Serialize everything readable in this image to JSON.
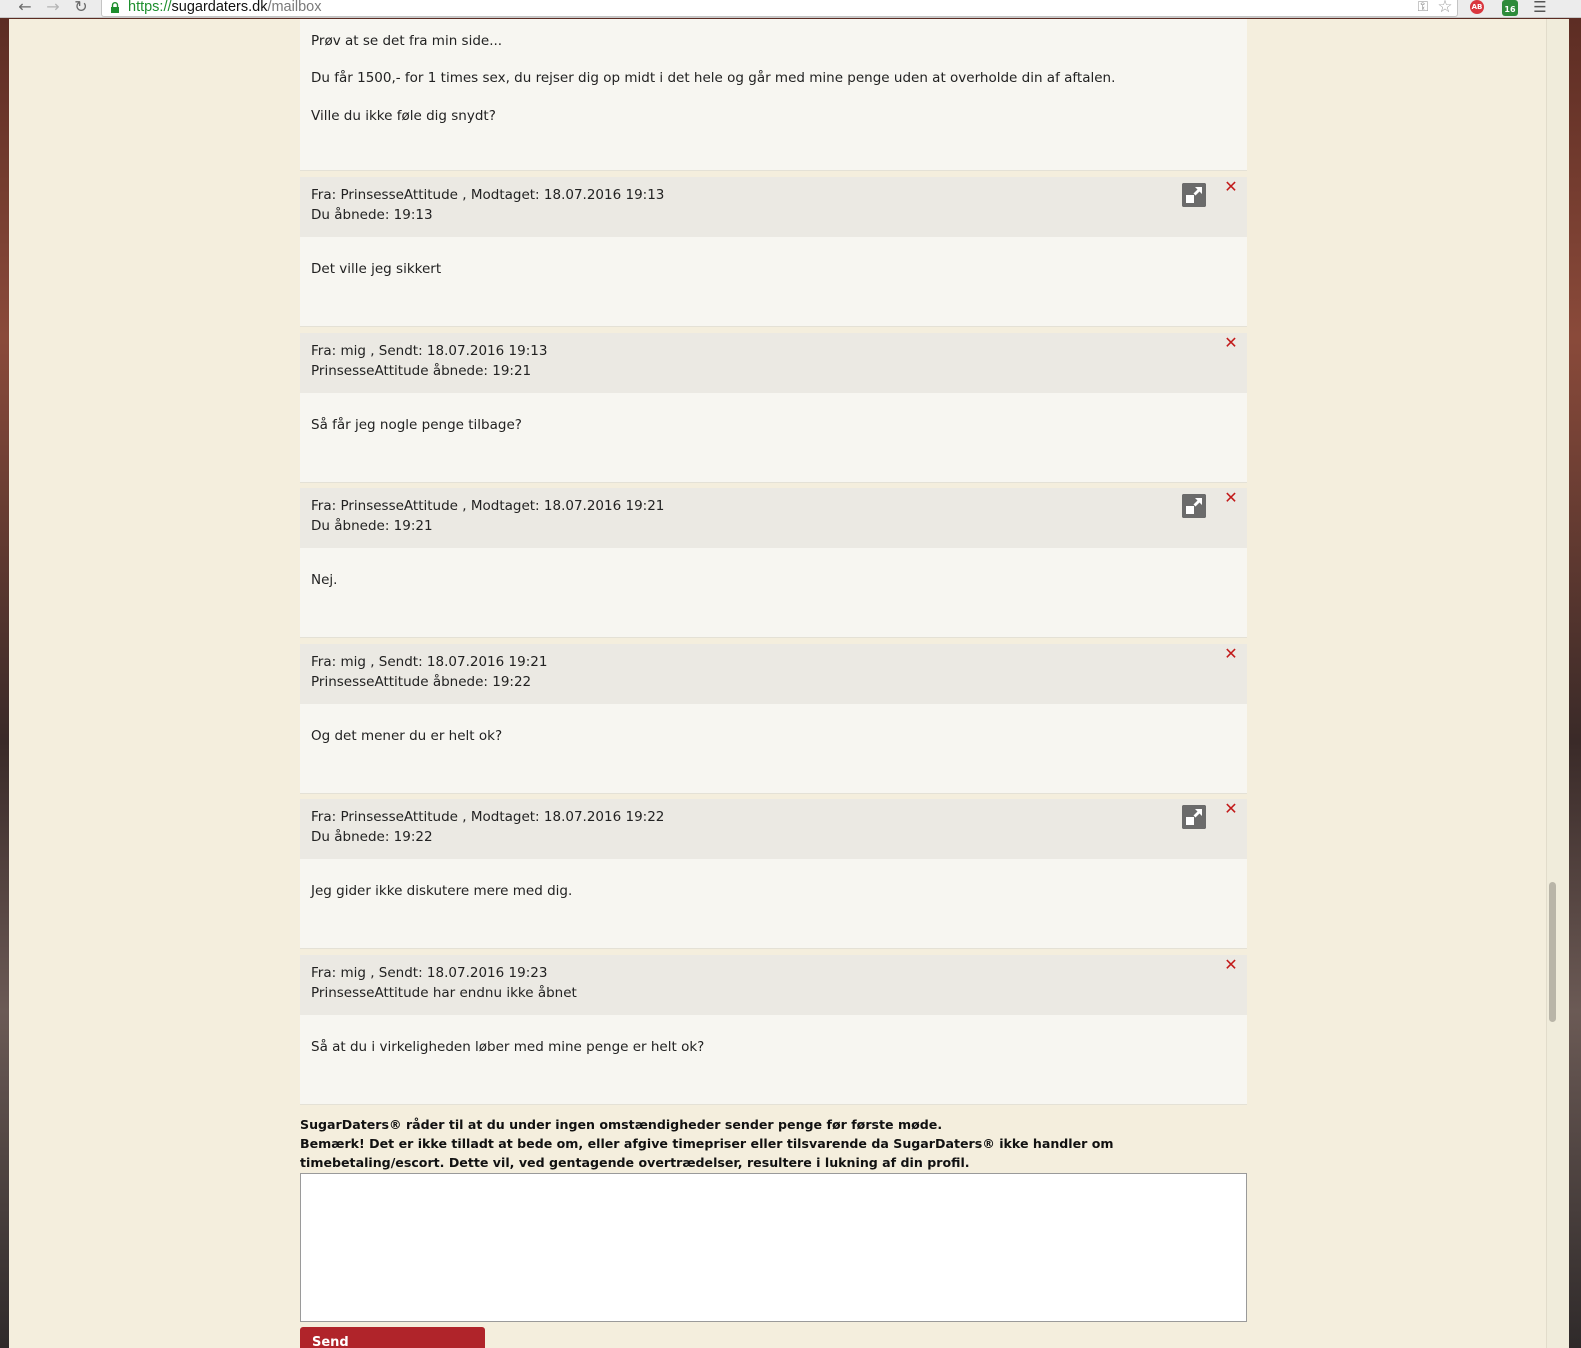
{
  "browser": {
    "url_scheme": "https://",
    "url_host": "sugardaters.dk",
    "url_path": "/mailbox",
    "back_glyph": "←",
    "forward_glyph": "→",
    "reload_glyph": "↻",
    "key_glyph": "⚿",
    "star_glyph": "☆",
    "adblock_text": "AB",
    "ext_text": "16",
    "menu_glyph": "☰"
  },
  "top_message": {
    "lines": [
      "Prøv at se det fra min side...",
      "Du får 1500,- for 1 times sex, du rejser dig op midt i det hele og går med mine penge uden at overholde din af aftalen.",
      "Ville du ikke føle dig snydt?"
    ]
  },
  "messages": [
    {
      "header1": "Fra: PrinsesseAttitude , Modtaget: 18.07.2016 19:13",
      "header2": "Du åbnede: 19:13",
      "body": "Det ville jeg sikkert",
      "has_profile_icon": true
    },
    {
      "header1": "Fra: mig , Sendt: 18.07.2016 19:13",
      "header2": "PrinsesseAttitude åbnede: 19:21",
      "body": "Så får jeg nogle penge tilbage?",
      "has_profile_icon": false
    },
    {
      "header1": "Fra: PrinsesseAttitude , Modtaget: 18.07.2016 19:21",
      "header2": "Du åbnede: 19:21",
      "body": "Nej.",
      "has_profile_icon": true
    },
    {
      "header1": "Fra: mig , Sendt: 18.07.2016 19:21",
      "header2": "PrinsesseAttitude åbnede: 19:22",
      "body": "Og det mener du er helt ok?",
      "has_profile_icon": false
    },
    {
      "header1": "Fra: PrinsesseAttitude , Modtaget: 18.07.2016 19:22",
      "header2": "Du åbnede: 19:22",
      "body": "Jeg gider ikke diskutere mere med dig.",
      "has_profile_icon": true
    },
    {
      "header1": "Fra: mig , Sendt: 18.07.2016 19:23",
      "header2": "PrinsesseAttitude har endnu ikke åbnet",
      "body": "Så at du i virkeligheden løber med mine penge er helt ok?",
      "has_profile_icon": false
    }
  ],
  "close_glyph": "✕",
  "warning": {
    "line1": "SugarDaters® råder til at du under ingen omstændigheder sender penge før første møde.",
    "line2": "Bemærk! Det er ikke tilladt at bede om, eller afgive timepriser eller tilsvarende da SugarDaters® ikke handler om timebetaling/escort. Dette vil, ved gentagende overtrædelser, resultere i lukning af din profil."
  },
  "reply": {
    "value": "",
    "send_label": "Send"
  },
  "colors": {
    "page_bg": "#f4eedd",
    "header_bg": "#ebe9e3",
    "body_bg": "#f7f6f1",
    "close_red": "#c21a1a",
    "button_red": "#b0242a",
    "url_green": "#1e8f2e"
  }
}
